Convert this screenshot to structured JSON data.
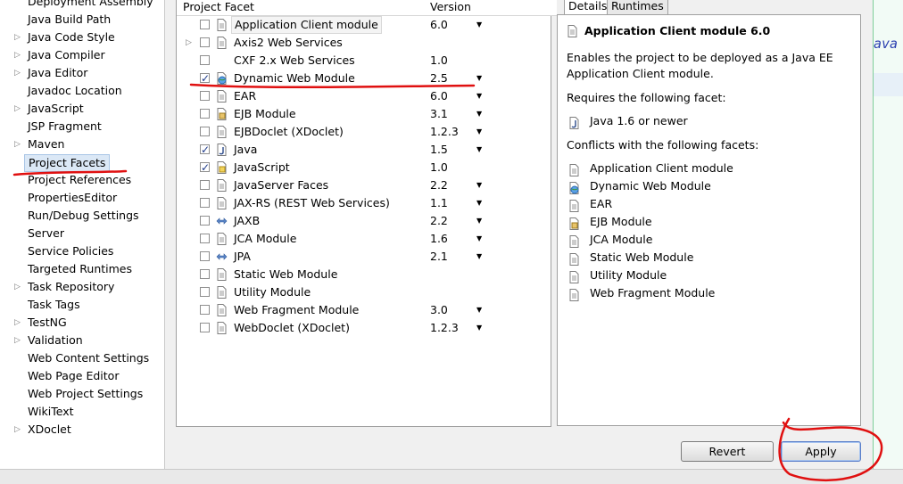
{
  "nav": {
    "items": [
      {
        "label": "Deployment Assembly",
        "expandable": false
      },
      {
        "label": "Java Build Path",
        "expandable": false
      },
      {
        "label": "Java Code Style",
        "expandable": true
      },
      {
        "label": "Java Compiler",
        "expandable": true
      },
      {
        "label": "Java Editor",
        "expandable": true
      },
      {
        "label": "Javadoc Location",
        "expandable": false
      },
      {
        "label": "JavaScript",
        "expandable": true
      },
      {
        "label": "JSP Fragment",
        "expandable": false
      },
      {
        "label": "Maven",
        "expandable": true
      },
      {
        "label": "Project Facets",
        "expandable": false,
        "selected": true
      },
      {
        "label": "Project References",
        "expandable": false
      },
      {
        "label": "PropertiesEditor",
        "expandable": false
      },
      {
        "label": "Run/Debug Settings",
        "expandable": false
      },
      {
        "label": "Server",
        "expandable": false
      },
      {
        "label": "Service Policies",
        "expandable": false
      },
      {
        "label": "Targeted Runtimes",
        "expandable": false
      },
      {
        "label": "Task Repository",
        "expandable": true
      },
      {
        "label": "Task Tags",
        "expandable": false
      },
      {
        "label": "TestNG",
        "expandable": true
      },
      {
        "label": "Validation",
        "expandable": true
      },
      {
        "label": "Web Content Settings",
        "expandable": false
      },
      {
        "label": "Web Page Editor",
        "expandable": false
      },
      {
        "label": "Web Project Settings",
        "expandable": false
      },
      {
        "label": "WikiText",
        "expandable": false
      },
      {
        "label": "XDoclet",
        "expandable": true
      }
    ]
  },
  "facets": {
    "header_facet": "Project Facet",
    "header_version": "Version",
    "rows": [
      {
        "name": "Application Client module",
        "version": "6.0",
        "checked": false,
        "dropdown": true,
        "icon": "page-icon",
        "boxed": true
      },
      {
        "name": "Axis2 Web Services",
        "version": "",
        "checked": false,
        "dropdown": false,
        "icon": "page-icon",
        "expandable": true
      },
      {
        "name": "CXF 2.x Web Services",
        "version": "1.0",
        "checked": false,
        "dropdown": false,
        "icon": "none"
      },
      {
        "name": "Dynamic Web Module",
        "version": "2.5",
        "checked": true,
        "dropdown": true,
        "icon": "globe-icon"
      },
      {
        "name": "EAR",
        "version": "6.0",
        "checked": false,
        "dropdown": true,
        "icon": "page-icon"
      },
      {
        "name": "EJB Module",
        "version": "3.1",
        "checked": false,
        "dropdown": true,
        "icon": "jar-icon"
      },
      {
        "name": "EJBDoclet (XDoclet)",
        "version": "1.2.3",
        "checked": false,
        "dropdown": true,
        "icon": "page-icon"
      },
      {
        "name": "Java",
        "version": "1.5",
        "checked": true,
        "dropdown": true,
        "icon": "java-icon"
      },
      {
        "name": "JavaScript",
        "version": "1.0",
        "checked": true,
        "dropdown": false,
        "icon": "js-icon"
      },
      {
        "name": "JavaServer Faces",
        "version": "2.2",
        "checked": false,
        "dropdown": true,
        "icon": "page-icon"
      },
      {
        "name": "JAX-RS (REST Web Services)",
        "version": "1.1",
        "checked": false,
        "dropdown": true,
        "icon": "page-icon"
      },
      {
        "name": "JAXB",
        "version": "2.2",
        "checked": false,
        "dropdown": true,
        "icon": "arrows-icon"
      },
      {
        "name": "JCA Module",
        "version": "1.6",
        "checked": false,
        "dropdown": true,
        "icon": "page-icon"
      },
      {
        "name": "JPA",
        "version": "2.1",
        "checked": false,
        "dropdown": true,
        "icon": "arrows-icon"
      },
      {
        "name": "Static Web Module",
        "version": "",
        "checked": false,
        "dropdown": false,
        "icon": "page-icon"
      },
      {
        "name": "Utility Module",
        "version": "",
        "checked": false,
        "dropdown": false,
        "icon": "page-icon"
      },
      {
        "name": "Web Fragment Module",
        "version": "3.0",
        "checked": false,
        "dropdown": true,
        "icon": "page-icon"
      },
      {
        "name": "WebDoclet (XDoclet)",
        "version": "1.2.3",
        "checked": false,
        "dropdown": true,
        "icon": "page-icon"
      }
    ]
  },
  "details": {
    "tab_details": "Details",
    "tab_runtimes": "Runtimes",
    "title": "Application Client module 6.0",
    "desc_line1": "Enables the project to be deployed as a Java EE",
    "desc_line2": "Application Client module.",
    "requires_label": "Requires the following facet:",
    "requires": [
      {
        "name": "Java 1.6 or newer",
        "icon": "java-icon"
      }
    ],
    "conflicts_label": "Conflicts with the following facets:",
    "conflicts": [
      {
        "name": "Application Client module",
        "icon": "page-icon"
      },
      {
        "name": "Dynamic Web Module",
        "icon": "globe-icon"
      },
      {
        "name": "EAR",
        "icon": "page-icon"
      },
      {
        "name": "EJB Module",
        "icon": "jar-icon"
      },
      {
        "name": "JCA Module",
        "icon": "page-icon"
      },
      {
        "name": "Static Web Module",
        "icon": "page-icon"
      },
      {
        "name": "Utility Module",
        "icon": "page-icon"
      },
      {
        "name": "Web Fragment Module",
        "icon": "page-icon"
      }
    ]
  },
  "buttons": {
    "revert": "Revert",
    "apply": "Apply"
  },
  "editor": {
    "fragment": "ava"
  },
  "annotation_color": "#e01010"
}
